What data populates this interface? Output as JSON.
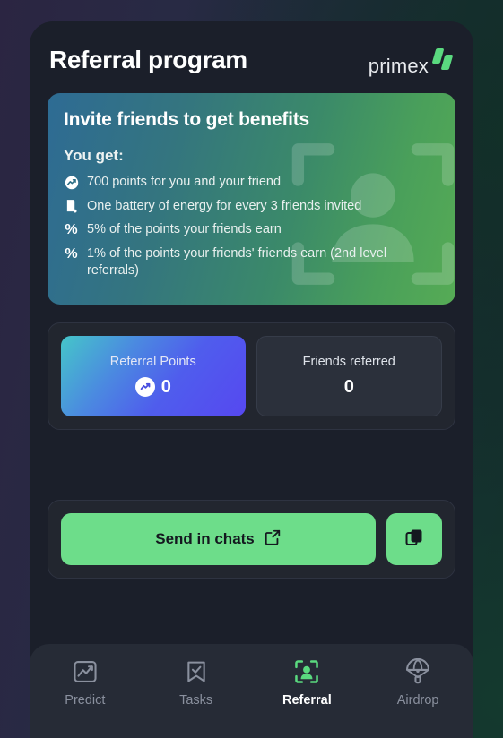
{
  "header": {
    "title": "Referral program",
    "brand": "primex"
  },
  "benefits": {
    "title": "Invite friends to get benefits",
    "subtitle": "You get:",
    "items": [
      {
        "icon": "points-circle-icon",
        "text": "700 points for you and your friend"
      },
      {
        "icon": "battery-icon",
        "text": "One battery of energy for every 3 friends invited"
      },
      {
        "icon": "percent-icon",
        "text": "5% of the points your friends earn"
      },
      {
        "icon": "percent-icon",
        "text": "1% of the points your friends' friends earn (2nd level referrals)"
      }
    ]
  },
  "stats": [
    {
      "label": "Referral Points",
      "value": "0",
      "icon": "points-circle-icon"
    },
    {
      "label": "Friends referred",
      "value": "0",
      "icon": ""
    }
  ],
  "share": {
    "send_label": "Send in chats",
    "send_icon": "external-link-icon",
    "copy_icon": "copy-icon"
  },
  "nav": [
    {
      "label": "Predict",
      "icon": "chart-frame-icon",
      "active": false
    },
    {
      "label": "Tasks",
      "icon": "bookmark-check-icon",
      "active": false
    },
    {
      "label": "Referral",
      "icon": "person-scan-icon",
      "active": true
    },
    {
      "label": "Airdrop",
      "icon": "parachute-icon",
      "active": false
    }
  ],
  "colors": {
    "accent_green": "#6ddd8a",
    "brand_green": "#5ad97f",
    "points_gradient_start": "#45c6c9",
    "points_gradient_end": "#5648f0",
    "panel_bg": "#1b1f2a",
    "nav_bg": "#262b36"
  }
}
